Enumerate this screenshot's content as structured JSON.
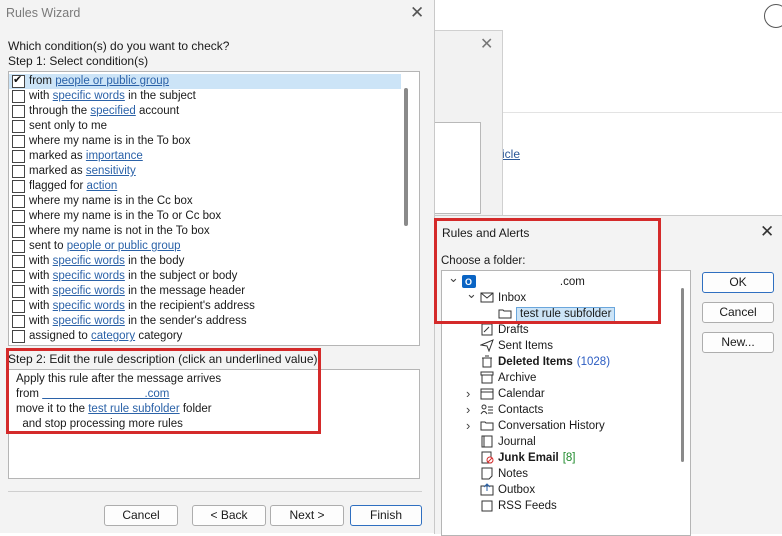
{
  "background_window": {
    "link_text": "icle"
  },
  "rules_wizard": {
    "title": "Rules Wizard",
    "question": "Which condition(s) do you want to check?",
    "step1": "Step 1: Select condition(s)",
    "conditions": [
      {
        "pre": "from ",
        "link": "people or public group",
        "post": "",
        "checked": true,
        "selected": true
      },
      {
        "pre": "with ",
        "link": "specific words",
        "post": " in the subject",
        "checked": false
      },
      {
        "pre": "through the ",
        "link": "specified",
        "post": " account",
        "checked": false
      },
      {
        "pre": "sent only to me",
        "link": "",
        "post": "",
        "checked": false
      },
      {
        "pre": "where my name is in the To box",
        "link": "",
        "post": "",
        "checked": false
      },
      {
        "pre": "marked as ",
        "link": "importance",
        "post": "",
        "checked": false
      },
      {
        "pre": "marked as ",
        "link": "sensitivity",
        "post": "",
        "checked": false
      },
      {
        "pre": "flagged for ",
        "link": "action",
        "post": "",
        "checked": false
      },
      {
        "pre": "where my name is in the Cc box",
        "link": "",
        "post": "",
        "checked": false
      },
      {
        "pre": "where my name is in the To or Cc box",
        "link": "",
        "post": "",
        "checked": false
      },
      {
        "pre": "where my name is not in the To box",
        "link": "",
        "post": "",
        "checked": false
      },
      {
        "pre": "sent to ",
        "link": "people or public group",
        "post": "",
        "checked": false
      },
      {
        "pre": "with ",
        "link": "specific words",
        "post": " in the body",
        "checked": false
      },
      {
        "pre": "with ",
        "link": "specific words",
        "post": " in the subject or body",
        "checked": false
      },
      {
        "pre": "with ",
        "link": "specific words",
        "post": " in the message header",
        "checked": false
      },
      {
        "pre": "with ",
        "link": "specific words",
        "post": " in the recipient's address",
        "checked": false
      },
      {
        "pre": "with ",
        "link": "specific words",
        "post": " in the sender's address",
        "checked": false
      },
      {
        "pre": "assigned to ",
        "link": "category",
        "post": " category",
        "checked": false
      }
    ],
    "step2": "Step 2: Edit the rule description (click an underlined value)",
    "description": {
      "line1": "Apply this rule after the message arrives",
      "line2_pre": "from ",
      "line2_link": "                                .com",
      "line3_pre": "move it to the ",
      "line3_link": "test rule subfolder",
      "line3_post": " folder",
      "line4": "  and stop processing more rules"
    },
    "buttons": {
      "cancel": "Cancel",
      "back": "< Back",
      "next": "Next >",
      "finish": "Finish"
    }
  },
  "rules_alerts": {
    "title": "Rules and Alerts",
    "choose": "Choose a folder:",
    "folders": [
      {
        "label": "                         .com",
        "count": "",
        "chev": "down",
        "icon": "outlook-icon",
        "indent": 0
      },
      {
        "label": "Inbox",
        "count": "",
        "chev": "down",
        "icon": "mail-icon",
        "indent": 1
      },
      {
        "label": "test rule subfolder",
        "count": "",
        "chev": "",
        "icon": "folder-icon",
        "indent": 2,
        "selected": true
      },
      {
        "label": "Drafts",
        "count": "",
        "chev": "",
        "icon": "drafts-icon",
        "indent": 1
      },
      {
        "label": "Sent Items",
        "count": "",
        "chev": "",
        "icon": "sent-icon",
        "indent": 1
      },
      {
        "label": "Deleted Items",
        "count": "(1028)",
        "bold": true,
        "countColor": "blue",
        "chev": "",
        "icon": "trash-icon",
        "indent": 1
      },
      {
        "label": "Archive",
        "count": "",
        "chev": "",
        "icon": "archive-icon",
        "indent": 1
      },
      {
        "label": "Calendar",
        "count": "",
        "chev": "right",
        "icon": "calendar-icon",
        "indent": 1
      },
      {
        "label": "Contacts",
        "count": "",
        "chev": "right",
        "icon": "contacts-icon",
        "indent": 1
      },
      {
        "label": "Conversation History",
        "count": "",
        "chev": "right",
        "icon": "folder-icon",
        "indent": 1
      },
      {
        "label": "Journal",
        "count": "",
        "chev": "",
        "icon": "journal-icon",
        "indent": 1
      },
      {
        "label": "Junk Email",
        "count": "[8]",
        "bold": true,
        "countColor": "green",
        "chev": "",
        "icon": "junk-icon",
        "indent": 1
      },
      {
        "label": "Notes",
        "count": "",
        "chev": "",
        "icon": "notes-icon",
        "indent": 1
      },
      {
        "label": "Outbox",
        "count": "",
        "chev": "",
        "icon": "outbox-icon",
        "indent": 1
      },
      {
        "label": "RSS Feeds",
        "count": "",
        "chev": "",
        "icon": "rss-icon",
        "indent": 1
      }
    ],
    "buttons": {
      "ok": "OK",
      "cancel": "Cancel",
      "new": "New..."
    }
  }
}
